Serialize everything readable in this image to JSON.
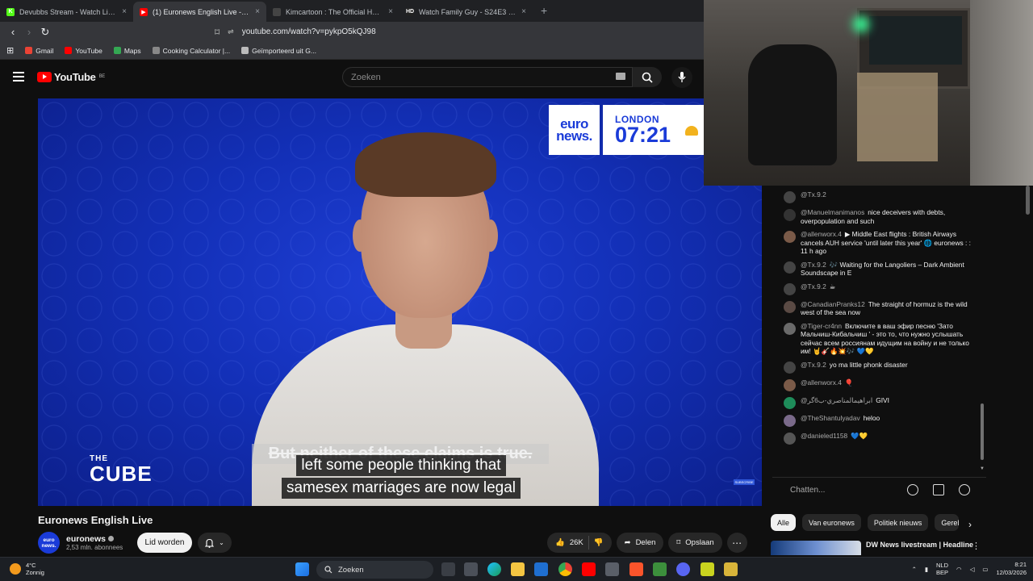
{
  "browser": {
    "tabs": [
      {
        "title": "Devubbs Stream - Watch Live on",
        "fav": "K",
        "color": "#53fc18",
        "active": false
      },
      {
        "title": "(1) Euronews English Live - Yo",
        "fav": "▶",
        "color": "#ff0000",
        "active": true
      },
      {
        "title": "Kimcartoon : The Official Home | kim",
        "fav": "",
        "color": "#444",
        "active": false
      },
      {
        "title": "Watch Family Guy - S24E3 | Online H",
        "fav": "HD",
        "color": "#222",
        "active": false
      }
    ],
    "url": "youtube.com/watch?v=pykpO5kQJ98",
    "bookmarks": [
      {
        "label": "Gmail",
        "color": "#ea4335"
      },
      {
        "label": "YouTube",
        "color": "#ff0000"
      },
      {
        "label": "Maps",
        "color": "#34a853"
      },
      {
        "label": "Cooking Calculator |...",
        "color": "#888"
      },
      {
        "label": "Geïmporteerd uit G...",
        "color": "#bbb"
      }
    ]
  },
  "youtube": {
    "logo_text": "YouTube",
    "region": "BE",
    "search_placeholder": "Zoeken"
  },
  "video": {
    "brand_top": "euro",
    "brand_bottom": "news.",
    "clock_city": "LONDON",
    "clock_time": "07:21",
    "show_small": "THE",
    "show_name": "CUBE",
    "ghost_caption": "But neither of these claims is true.",
    "caption_lines": [
      "left some people thinking that",
      "samesex marriages are now legal"
    ],
    "subscribe_badge": "SUBSCRIBE"
  },
  "chat": {
    "messages": [
      {
        "author": "@Tx.9.2",
        "text": "",
        "avatar_color": "#444"
      },
      {
        "author": "@Manuelmanimanos",
        "text": "nice deceivers with debts, overpopulation and such",
        "avatar_color": "#333"
      },
      {
        "author": "@allenworx.4",
        "text": "▶ Middle East flights : British Airways cancels AUH service 'until later this year' 🌐 euronews : : 11 h ago",
        "avatar_color": "#7a5a48"
      },
      {
        "author": "@Tx.9.2",
        "text": "🎶 Waiting for the Langoliers – Dark Ambient Soundscape in E",
        "avatar_color": "#444"
      },
      {
        "author": "@Tx.9.2",
        "text": "☕",
        "avatar_color": "#444"
      },
      {
        "author": "@CanadianPranks12",
        "text": "The straight of hormuz is the wild west of the sea now",
        "avatar_color": "#5a4a44"
      },
      {
        "author": "@Tiger-cr4nn",
        "text": "Включите в ваш эфир песню 'Зато Мальчиш-Кибальчиш ' - это то, что нужно услышать сейчас всем россиянам идущим на войну и не только им! 🤘🎸🔥💥🎶 💙💛",
        "avatar_color": "#6a6a6a"
      },
      {
        "author": "@Tx.9.2",
        "text": "yo ma little phonk disaster",
        "avatar_color": "#444"
      },
      {
        "author": "@allenworx.4",
        "text": "🎈",
        "avatar_color": "#7a5a48"
      },
      {
        "author": "@ابراهيمالمناصري-ب6گر",
        "text": "GIVI",
        "avatar_color": "#1e8c5a"
      },
      {
        "author": "@TheShantulyadav",
        "text": "heloo",
        "avatar_color": "#7a6a8a"
      },
      {
        "author": "@danieled1158",
        "text": "💙💛",
        "avatar_color": "#555"
      }
    ],
    "input_placeholder": "Chatten..."
  },
  "below": {
    "title": "Euronews English Live",
    "channel_name": "euronews",
    "channel_logo": "euro news.",
    "subscribers": "2,53 mln. abonnees",
    "join_label": "Lid worden",
    "likes": "26K",
    "share_label": "Delen",
    "save_label": "Opslaan"
  },
  "chips": [
    "Alle",
    "Van euronews",
    "Politiek nieuws",
    "Gerel"
  ],
  "recommendation": {
    "title": "DW News livestream | Headline"
  },
  "taskbar": {
    "temperature": "4°C",
    "weather": "Zonnig",
    "search_label": "Zoeken",
    "lang_top": "NLD",
    "lang_bottom": "BEP",
    "time": "8:21",
    "date": "12/03/2026"
  }
}
